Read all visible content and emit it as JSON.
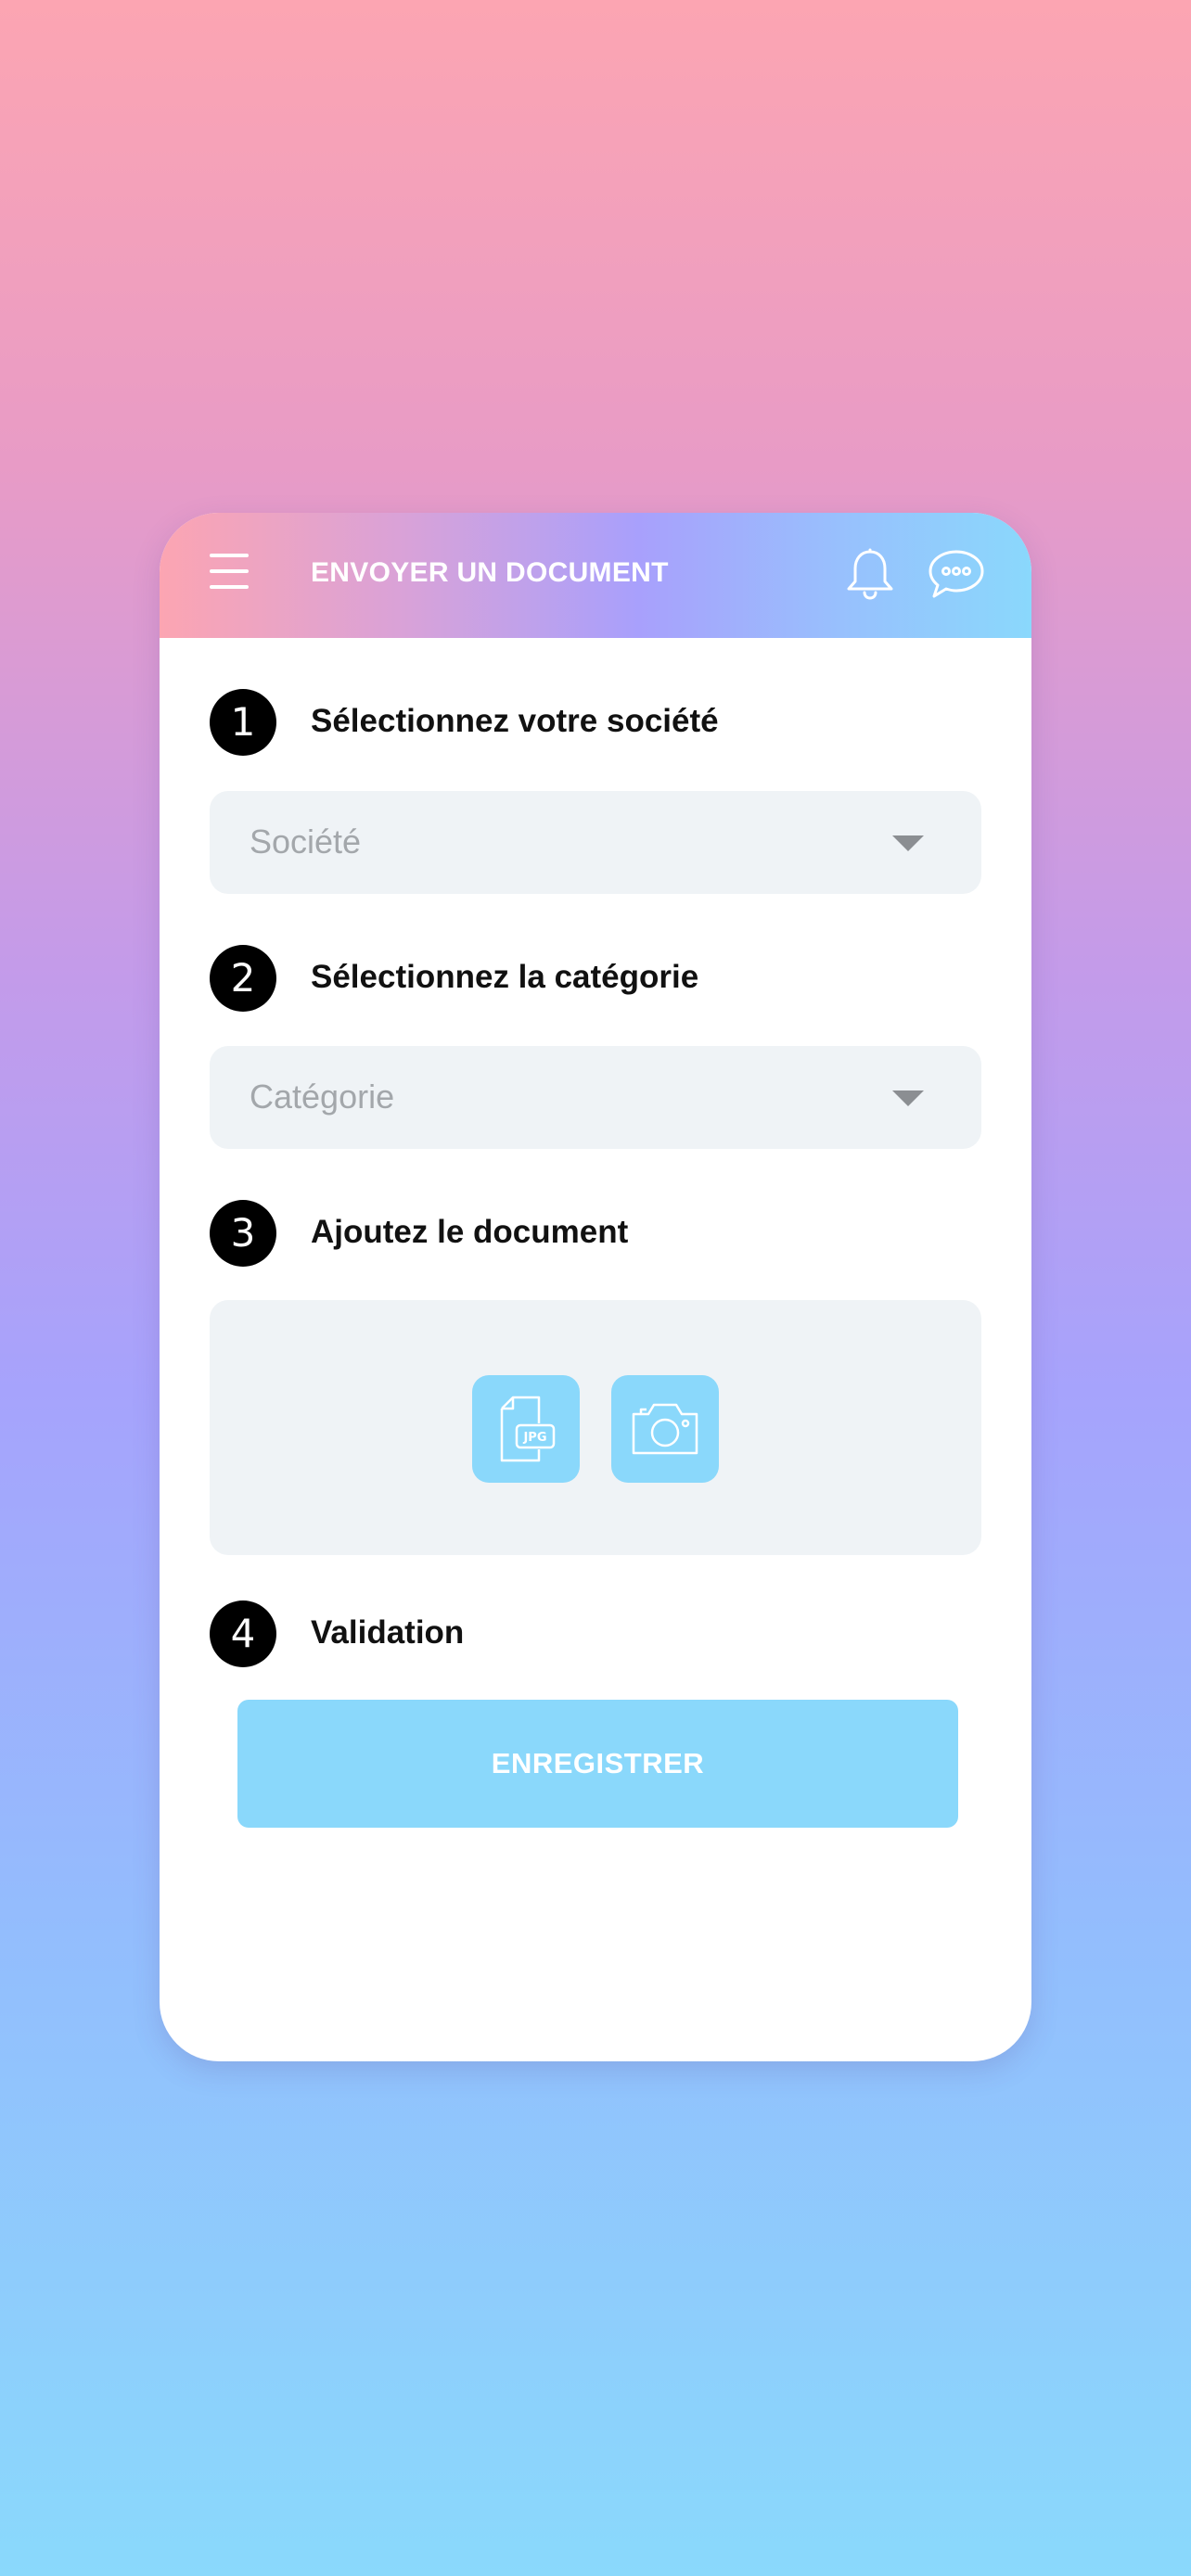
{
  "header": {
    "title": "ENVOYER UN DOCUMENT",
    "icons": [
      "menu-icon",
      "bell-icon",
      "chat-icon"
    ]
  },
  "steps": [
    {
      "number": "1",
      "title": "Sélectionnez votre société"
    },
    {
      "number": "2",
      "title": "Sélectionnez la catégorie"
    },
    {
      "number": "3",
      "title": "Ajoutez le document"
    },
    {
      "number": "4",
      "title": "Validation"
    }
  ],
  "company_select": {
    "placeholder": "Société"
  },
  "category_select": {
    "placeholder": "Catégorie"
  },
  "upload": {
    "jpg_badge": "JPG",
    "icons": [
      "jpg-file-icon",
      "camera-icon"
    ]
  },
  "save_button": {
    "label": "ENREGISTRER"
  },
  "colors": {
    "accent": "#8ad8fb",
    "field_background": "#eff3f6",
    "step_badge": "#000000",
    "placeholder_text": "#a3a7ab"
  }
}
